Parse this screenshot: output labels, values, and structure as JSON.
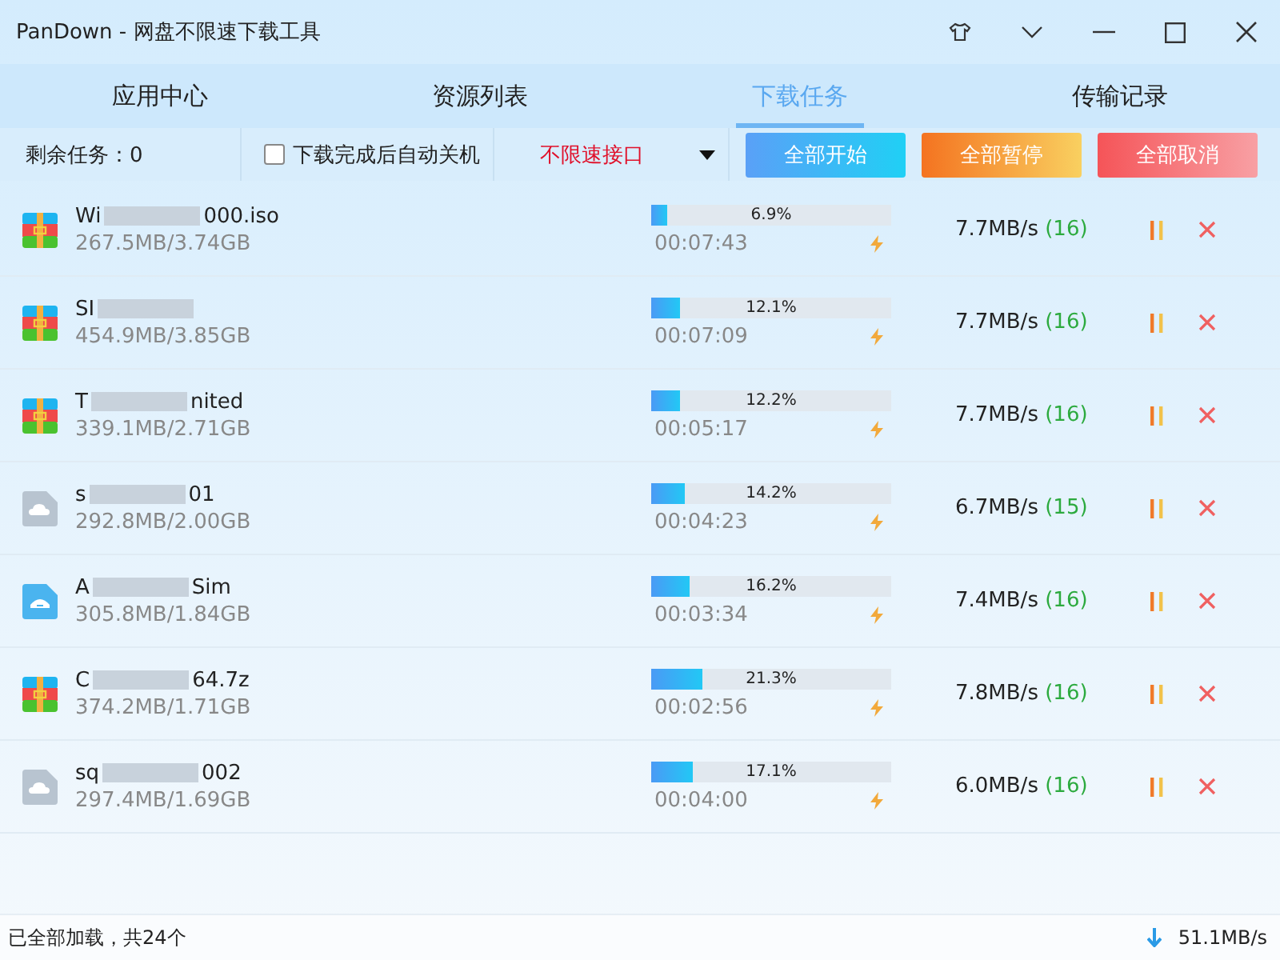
{
  "window": {
    "title": "PanDown - 网盘不限速下载工具"
  },
  "tabs": [
    {
      "label": "应用中心",
      "selected": false
    },
    {
      "label": "资源列表",
      "selected": false
    },
    {
      "label": "下载任务",
      "selected": true
    },
    {
      "label": "传输记录",
      "selected": false
    }
  ],
  "toolbar": {
    "remaining": "剩余任务：0",
    "shutdown_option": {
      "label": "下载完成后自动关机",
      "checked": false
    },
    "interface_select": {
      "value": "不限速接口"
    },
    "buttons": [
      {
        "label": "全部开始",
        "kind": "start"
      },
      {
        "label": "全部暂停",
        "kind": "pause"
      },
      {
        "label": "全部取消",
        "kind": "cancel"
      }
    ]
  },
  "tasks": [
    {
      "kind": "archive",
      "name_start": "Wi",
      "name_end": "000.iso",
      "size": "267.5MB/3.74GB",
      "percent": "6.9%",
      "level": 0.069,
      "time_left": "00:07:43",
      "speed": "7.7MB/s",
      "threads": "(16)"
    },
    {
      "kind": "archive",
      "name_start": "SI",
      "size": "454.9MB/3.85GB",
      "percent": "12.1%",
      "level": 0.121,
      "time_left": "00:07:09",
      "speed": "7.7MB/s",
      "threads": "(16)"
    },
    {
      "kind": "archive",
      "name_start": "T",
      "name_end": "nited",
      "size": "339.1MB/2.71GB",
      "percent": "12.2%",
      "level": 0.122,
      "time_left": "00:05:17",
      "speed": "7.7MB/s",
      "threads": "(16)"
    },
    {
      "kind": "cloud",
      "name_start": "s",
      "name_end": "01",
      "size": "292.8MB/2.00GB",
      "percent": "14.2%",
      "level": 0.142,
      "time_left": "00:04:23",
      "speed": "6.7MB/s",
      "threads": "(15)"
    },
    {
      "kind": "disk",
      "name_start": "A",
      "name_end": "Sim",
      "size": "305.8MB/1.84GB",
      "percent": "16.2%",
      "level": 0.162,
      "time_left": "00:03:34",
      "speed": "7.4MB/s",
      "threads": "(16)"
    },
    {
      "kind": "archive",
      "name_start": "C",
      "name_end": "64.7z",
      "size": "374.2MB/1.71GB",
      "percent": "21.3%",
      "level": 0.213,
      "time_left": "00:02:56",
      "speed": "7.8MB/s",
      "threads": "(16)"
    },
    {
      "kind": "cloud",
      "name_start": "sq",
      "name_end": "002",
      "size": "297.4MB/1.69GB",
      "percent": "17.1%",
      "level": 0.171,
      "time_left": "00:04:00",
      "speed": "6.0MB/s",
      "threads": "(16)"
    }
  ],
  "status_bar": {
    "summary": "已全部加载，共24个",
    "total_speed": "51.1MB/s"
  }
}
